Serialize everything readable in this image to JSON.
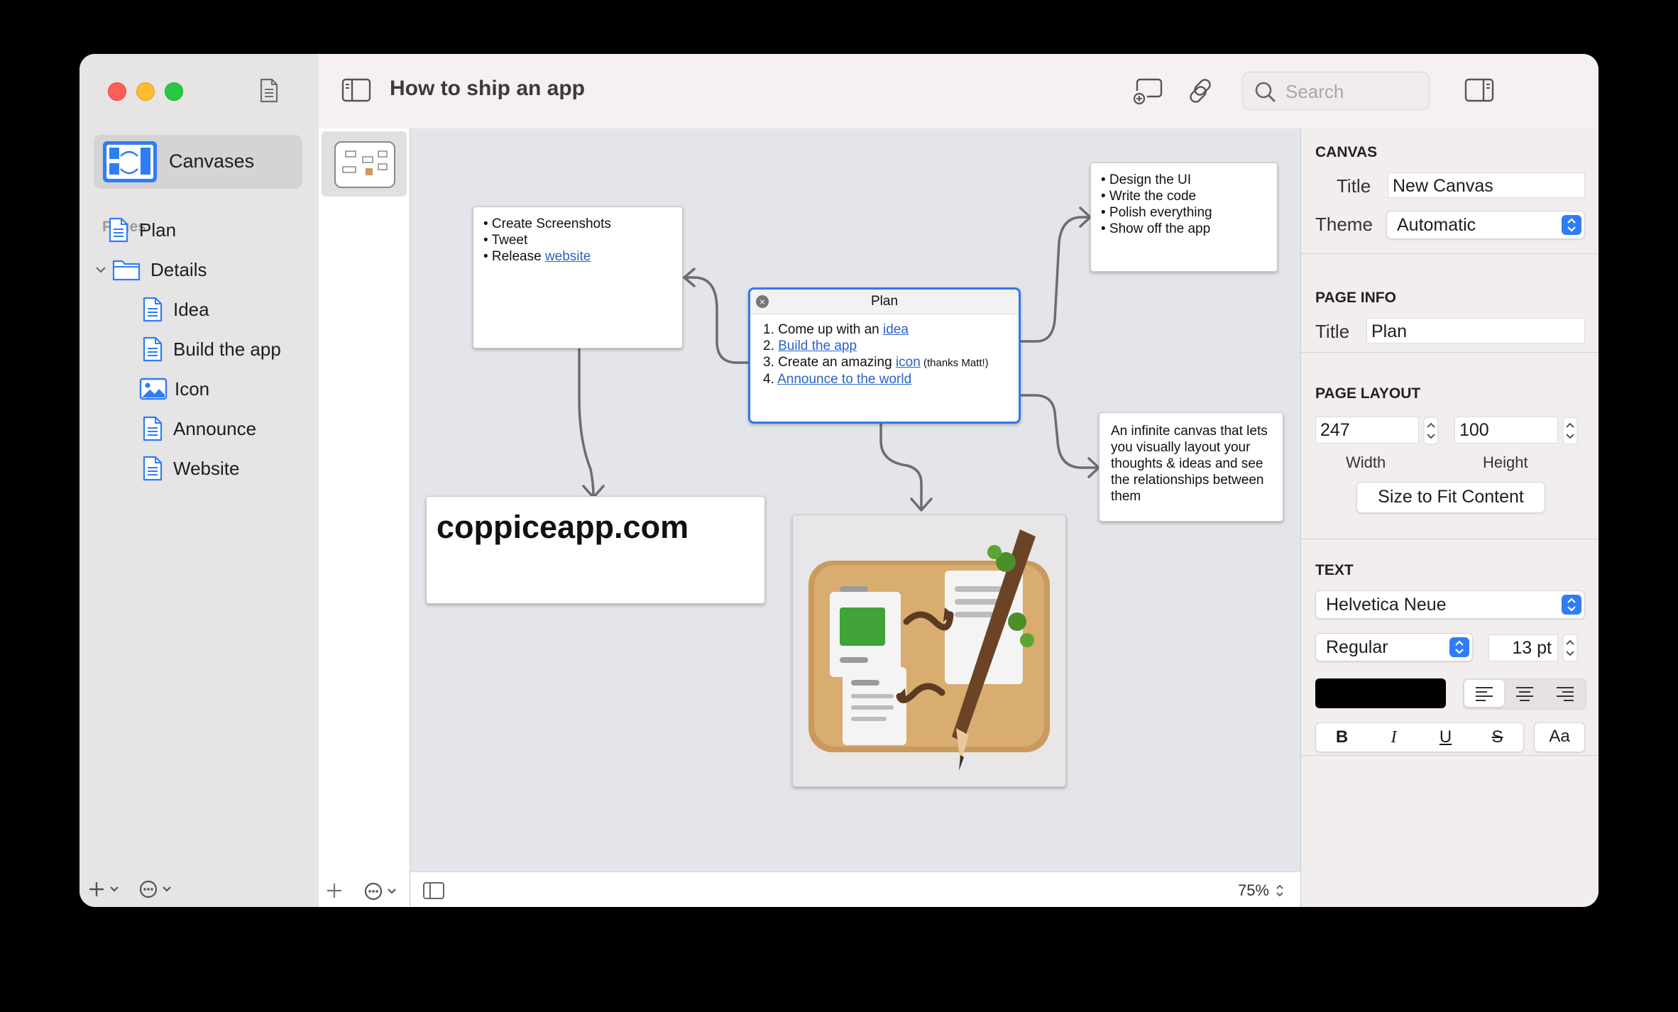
{
  "window": {
    "title": "How to ship an app"
  },
  "sidebar": {
    "canvases_label": "Canvases",
    "pages_header": "Pages",
    "items": [
      {
        "label": "Plan",
        "icon": "document-icon"
      },
      {
        "label": "Details",
        "icon": "folder-icon"
      },
      {
        "label": "Idea",
        "icon": "document-icon"
      },
      {
        "label": "Build the app",
        "icon": "document-icon"
      },
      {
        "label": "Icon",
        "icon": "image-icon"
      },
      {
        "label": "Announce",
        "icon": "document-icon"
      },
      {
        "label": "Website",
        "icon": "document-icon"
      }
    ]
  },
  "toolbar": {
    "search_placeholder": "Search"
  },
  "canvas": {
    "card_screenshots": {
      "line1": "• Create Screenshots",
      "line2": "• Tweet",
      "line3_prefix": "• Release ",
      "line3_link": "website"
    },
    "card_design": {
      "line1": "• Design the UI",
      "line2": "• Write the code",
      "line3": "• Polish everything",
      "line4": "• Show off the app"
    },
    "card_plan": {
      "title": "Plan",
      "i1_prefix": "1. Come up with an ",
      "i1_link": "idea",
      "i2_prefix": "2. ",
      "i2_link": "Build the app",
      "i3_prefix": "3. Create an amazing ",
      "i3_link": "icon",
      "i3_small": " (thanks Matt!)",
      "i4_prefix": "4. ",
      "i4_link": "Announce to the world"
    },
    "card_infinite": {
      "text": "An infinite canvas that lets you visually layout your thoughts & ideas and see the relationships between them"
    },
    "card_website": {
      "text": "coppiceapp.com"
    },
    "zoom": "75%"
  },
  "inspector": {
    "canvas": {
      "header": "CANVAS",
      "title_label": "Title",
      "title_value": "New Canvas",
      "theme_label": "Theme",
      "theme_value": "Automatic"
    },
    "page_info": {
      "header": "PAGE INFO",
      "title_label": "Title",
      "title_value": "Plan"
    },
    "page_layout": {
      "header": "PAGE LAYOUT",
      "width_value": "247",
      "height_value": "100",
      "width_label": "Width",
      "height_label": "Height",
      "fit_button": "Size to Fit Content"
    },
    "text": {
      "header": "TEXT",
      "font": "Helvetica Neue",
      "style": "Regular",
      "size": "13 pt",
      "color": "#000000",
      "bold": "B",
      "italic": "I",
      "underline": "U",
      "strike": "S",
      "case": "Aa"
    }
  },
  "colors": {
    "accent": "#2f7df6",
    "link": "#2a62c9",
    "selection": "#3476e8"
  }
}
